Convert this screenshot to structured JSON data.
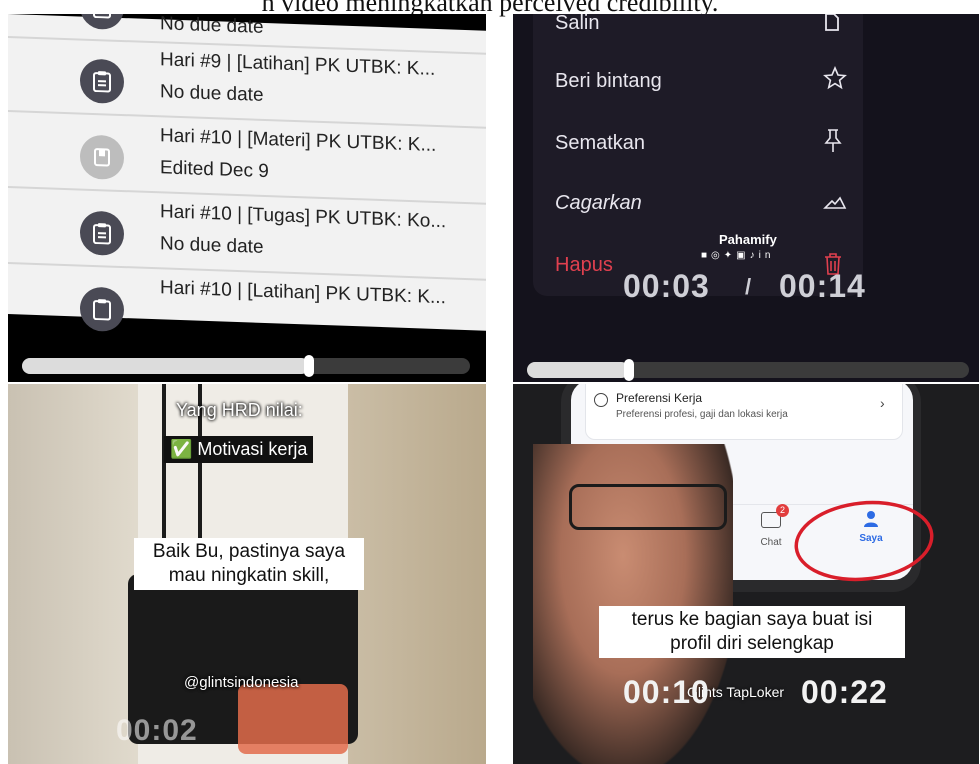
{
  "caption_top": "n video meningkatkan perceived credibility.",
  "panel1": {
    "tasks": [
      {
        "title": "No due date",
        "sub": ""
      },
      {
        "title": "Hari #9 | [Latihan] PK UTBK: K...",
        "sub": "No due date"
      },
      {
        "title": "Hari #10 | [Materi] PK UTBK: K...",
        "sub": "Edited Dec 9"
      },
      {
        "title": "Hari #10 | [Tugas] PK UTBK: Ko...",
        "sub": "No due date"
      },
      {
        "title": "Hari #10 | [Latihan] PK UTBK: K...",
        "sub": ""
      }
    ],
    "progress": 0.64
  },
  "panel2": {
    "menu": [
      {
        "label": "Salin",
        "icon": "copy-icon"
      },
      {
        "label": "Beri bintang",
        "icon": "star-icon"
      },
      {
        "label": "Sematkan",
        "icon": "pin-icon"
      },
      {
        "label": "Cagarkan",
        "icon": "archive-icon"
      },
      {
        "label": "Hapus",
        "icon": "trash-icon"
      }
    ],
    "brand": "Pahamify",
    "time_current": "00:03",
    "time_sep": "/",
    "time_total": "00:14",
    "progress": 0.23,
    "delete_color": "#e0404f"
  },
  "panel3": {
    "heading": "Yang HRD nilai:",
    "badge": "✅ Motivasi kerja",
    "caption_line1": "Baik Bu, pastinya saya",
    "caption_line2": "mau ningkatin skill,",
    "handle": "@glintsindonesia",
    "time_current": "00:02"
  },
  "panel4": {
    "card_title": "Preferensi Kerja",
    "card_sub": "Preferensi profesi, gaji dan lokasi kerja",
    "nav_chat": "Chat",
    "nav_chat_badge": "2",
    "nav_saya": "Saya",
    "caption_line1": "terus ke bagian saya buat isi",
    "caption_line2": "profil diri selengkap",
    "watermark": "Glints TapLoker",
    "time_current": "00:10",
    "time_total": "00:22",
    "accent": "#2d6be4",
    "circle_color": "#d91e2a"
  }
}
